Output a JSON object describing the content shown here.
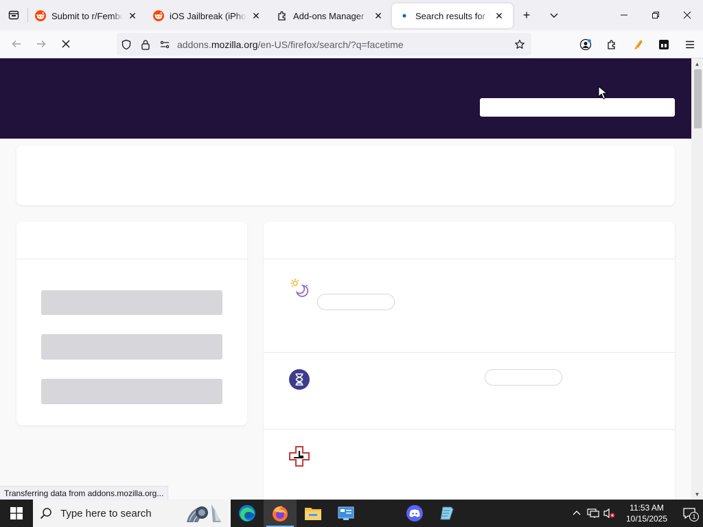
{
  "browser": {
    "tabs": [
      {
        "title": "Submit to r/FemboyHo",
        "favicon": "reddit-icon",
        "active": false
      },
      {
        "title": "iOS Jailbreak (iPhone, iPad",
        "favicon": "reddit-icon",
        "active": false
      },
      {
        "title": "Add-ons Manager",
        "favicon": "puzzle-icon",
        "active": false
      },
      {
        "title": "Search results for \"facetime\"",
        "favicon": "loading-dot-icon",
        "active": true
      }
    ],
    "url_prefix": "addons.",
    "url_domain": "mozilla.org",
    "url_path": "/en-US/firefox/search/?q=facetime",
    "status_text": "Transferring data from addons.mozilla.org..."
  },
  "colors": {
    "amo_header": "#20123a",
    "reddit_orange": "#ff4500",
    "taskbar": "#1f1f1f",
    "skeleton": "#d7d7db"
  },
  "page": {
    "search_placeholder": "",
    "results": [
      {
        "icon": "moon-sun-icon"
      },
      {
        "icon": "hourglass-icon"
      },
      {
        "icon": "clock-plus-icon"
      }
    ]
  },
  "taskbar": {
    "search_placeholder": "Type here to search",
    "time": "11:53 AM",
    "date": "10/15/2025",
    "notification_count": "1",
    "apps": [
      "edge-icon",
      "firefox-icon",
      "file-explorer-icon",
      "control-panel-icon",
      "discord-icon",
      "notepad-icon"
    ]
  }
}
